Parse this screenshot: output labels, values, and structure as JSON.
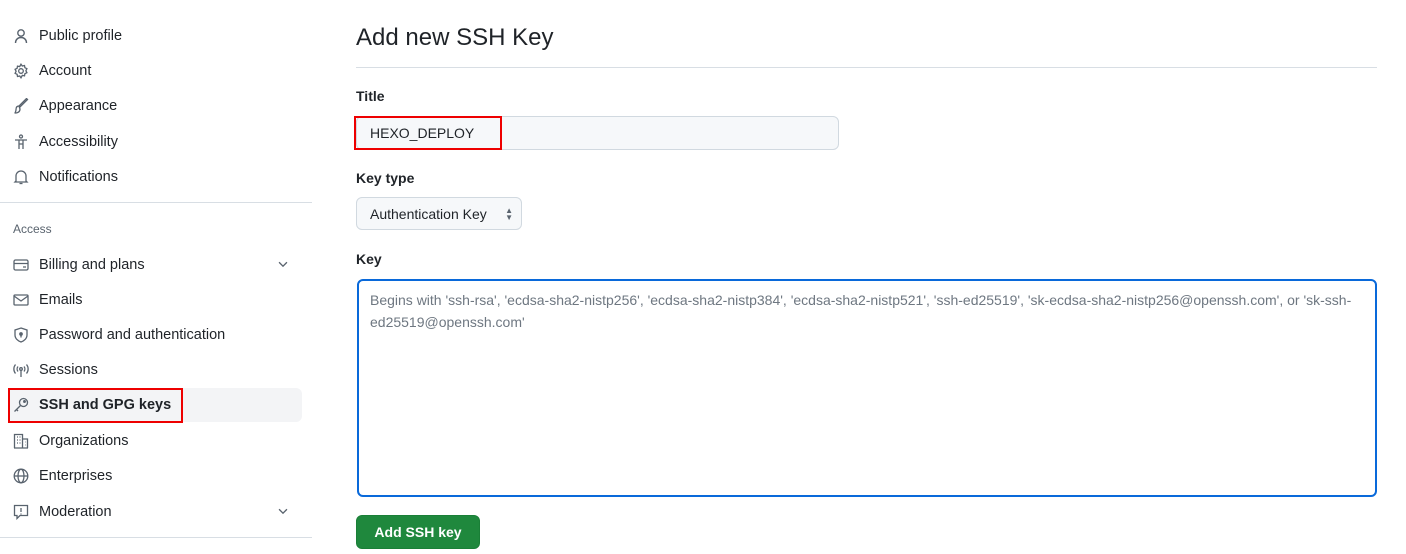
{
  "sidebar": {
    "items": [
      {
        "label": "Public profile",
        "icon": "person-icon"
      },
      {
        "label": "Account",
        "icon": "gear-icon"
      },
      {
        "label": "Appearance",
        "icon": "paintbrush-icon"
      },
      {
        "label": "Accessibility",
        "icon": "accessibility-icon"
      },
      {
        "label": "Notifications",
        "icon": "bell-icon"
      }
    ],
    "section_label": "Access",
    "access_items": [
      {
        "label": "Billing and plans",
        "icon": "credit-card-icon",
        "expandable": true
      },
      {
        "label": "Emails",
        "icon": "mail-icon"
      },
      {
        "label": "Password and authentication",
        "icon": "shield-lock-icon"
      },
      {
        "label": "Sessions",
        "icon": "broadcast-icon"
      },
      {
        "label": "SSH and GPG keys",
        "icon": "key-icon",
        "active": true
      },
      {
        "label": "Organizations",
        "icon": "organization-icon"
      },
      {
        "label": "Enterprises",
        "icon": "globe-icon"
      },
      {
        "label": "Moderation",
        "icon": "report-icon",
        "expandable": true
      }
    ]
  },
  "main": {
    "title": "Add new SSH Key",
    "title_label": "Title",
    "title_value": "HEXO_DEPLOY",
    "key_type_label": "Key type",
    "key_type_value": "Authentication Key",
    "key_label": "Key",
    "key_placeholder": "Begins with 'ssh-rsa', 'ecdsa-sha2-nistp256', 'ecdsa-sha2-nistp384', 'ecdsa-sha2-nistp521', 'ssh-ed25519', 'sk-ecdsa-sha2-nistp256@openssh.com', or 'sk-ssh-ed25519@openssh.com'",
    "submit_label": "Add SSH key"
  },
  "colors": {
    "accent": "#0969da",
    "primary_button": "#1f883d",
    "highlight_box": "#ee0000"
  }
}
